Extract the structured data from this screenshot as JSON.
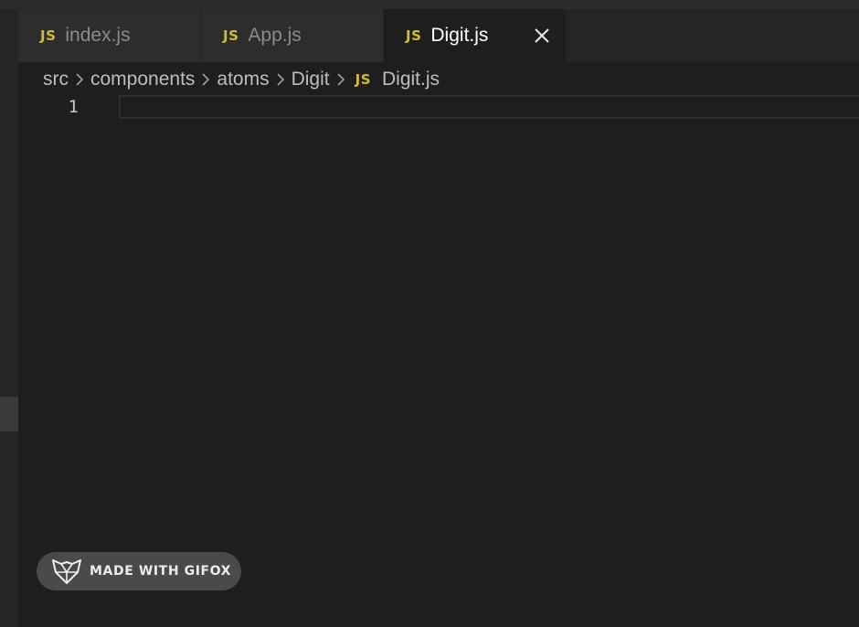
{
  "tabs": [
    {
      "icon": "JS",
      "label": "index.js",
      "active": false
    },
    {
      "icon": "JS",
      "label": "App.js",
      "active": false
    },
    {
      "icon": "JS",
      "label": "Digit.js",
      "active": true
    }
  ],
  "breadcrumb": {
    "items": [
      "src",
      "components",
      "atoms",
      "Digit"
    ],
    "file_icon": "JS",
    "file": "Digit.js"
  },
  "editor": {
    "line_numbers": [
      "1"
    ]
  },
  "watermark": {
    "text": "MADE WITH GIFOX"
  },
  "colors": {
    "background": "#1e1e1e",
    "tab_inactive": "#2d2d2d",
    "js_icon": "#d7ba2a",
    "badge": "#4a4a4a"
  },
  "icons": {
    "close": "close-icon",
    "separator": "chevron-right-icon",
    "watermark_logo": "fox-logo-icon"
  }
}
